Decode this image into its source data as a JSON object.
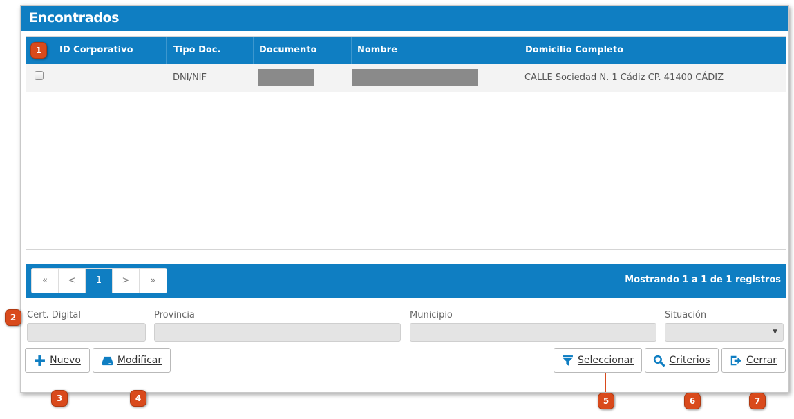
{
  "panel": {
    "title": "Encontrados"
  },
  "grid": {
    "columns": [
      "ID Corporativo",
      "Tipo Doc.",
      "Documento",
      "Nombre",
      "Domicilio Completo"
    ],
    "rows": [
      {
        "id_corporativo": "",
        "tipo_doc": "DNI/NIF",
        "documento": "",
        "nombre": "",
        "domicilio": "CALLE Sociedad N. 1 Cádiz CP. 41400 CÁDIZ",
        "selected": false
      }
    ]
  },
  "pagination": {
    "first": "«",
    "prev": "<",
    "current": "1",
    "next": ">",
    "last": "»",
    "summary": "Mostrando 1 a 1 de 1 registros"
  },
  "fields": {
    "cert_digital": {
      "label": "Cert. Digital",
      "value": ""
    },
    "provincia": {
      "label": "Provincia",
      "value": ""
    },
    "municipio": {
      "label": "Municipio",
      "value": ""
    },
    "situacion": {
      "label": "Situación",
      "value": ""
    }
  },
  "buttons": {
    "nuevo": {
      "label": "Nuevo",
      "icon": "plus-icon"
    },
    "modificar": {
      "label": "Modificar",
      "icon": "drive-icon"
    },
    "seleccionar": {
      "label": "Seleccionar",
      "icon": "filter-icon"
    },
    "criterios": {
      "label": "Criterios",
      "icon": "search-icon"
    },
    "cerrar": {
      "label": "Cerrar",
      "icon": "exit-icon"
    }
  },
  "callouts": [
    "1",
    "2",
    "3",
    "4",
    "5",
    "6",
    "7"
  ],
  "colors": {
    "primary": "#0f7ec2",
    "callout": "#d94a1c",
    "field_bg": "#e4e4e4"
  }
}
